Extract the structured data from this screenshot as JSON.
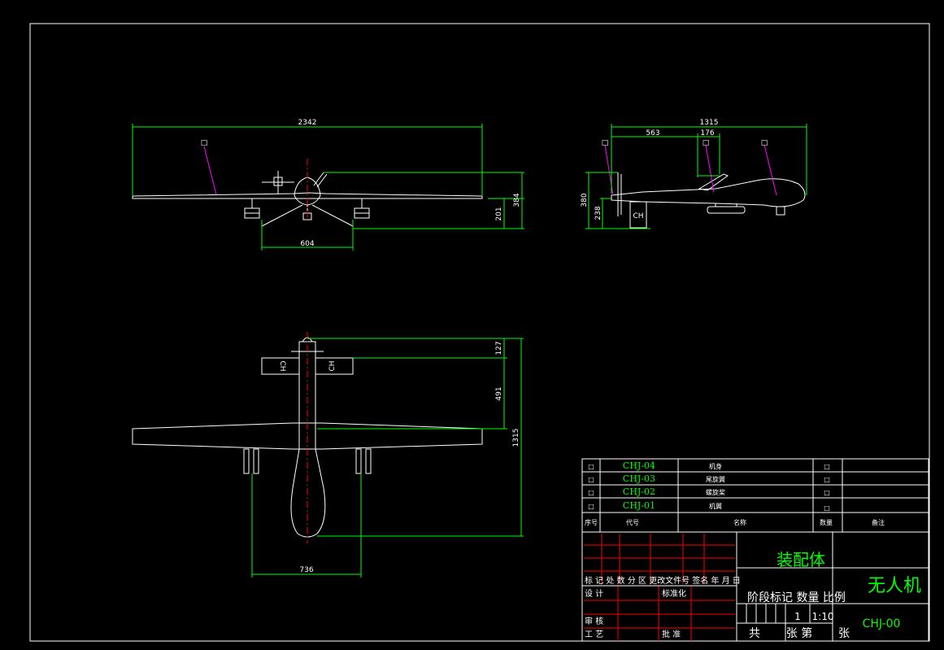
{
  "views": {
    "front": {
      "dims": {
        "span": "2342",
        "gear_track": "604",
        "height_total": "384",
        "height_lower": "201"
      },
      "balloon": "□"
    },
    "side": {
      "dims": {
        "length": "1315",
        "seg1": "563",
        "seg2": "176",
        "height_total": "380",
        "height_lower": "238"
      },
      "balloons": [
        "□",
        "□",
        "□"
      ],
      "tail_marking": "CH"
    },
    "top": {
      "dims": {
        "tail_offset": "127",
        "fuselage_seg": "491",
        "length": "1315",
        "gear_track": "736"
      },
      "stab_marking_left": "CH",
      "stab_marking_right": "CH"
    }
  },
  "parts_list": {
    "rows": [
      {
        "no": "□",
        "code": "CHJ-04",
        "name": "机身",
        "qty": "□",
        "note": ""
      },
      {
        "no": "□",
        "code": "CHJ-03",
        "name": "尾旋翼",
        "qty": "□",
        "note": ""
      },
      {
        "no": "□",
        "code": "CHJ-02",
        "name": "螺旋桨",
        "qty": "□",
        "note": ""
      },
      {
        "no": "□",
        "code": "CHJ-01",
        "name": "机翼",
        "qty": "□",
        "note": ""
      }
    ],
    "header": {
      "no": "序号",
      "code": "代号",
      "name": "名称",
      "qty": "数量",
      "note": "备注"
    }
  },
  "title_block": {
    "assembly_label": "装配体",
    "title": "无人机",
    "drawing_no": "CHJ-00",
    "rev_row": "标 记 处 数  分 区 更改文件号 签名 年 月 日",
    "stage_header": "阶段标记 数量 比例",
    "qty": "1",
    "scale": "1:10",
    "sheet_total": "共",
    "sheet_num": "张 第",
    "sheet_unit": "张",
    "roles": {
      "design": "设 计",
      "standardize": "标准化",
      "review": "审 核",
      "process": "工 艺",
      "approve": "批 准"
    }
  },
  "colors": {
    "outline": "#ffffff",
    "dimension": "#00ff00",
    "centerline": "#ff0000",
    "leader": "#ff00ff",
    "background": "#000000"
  }
}
